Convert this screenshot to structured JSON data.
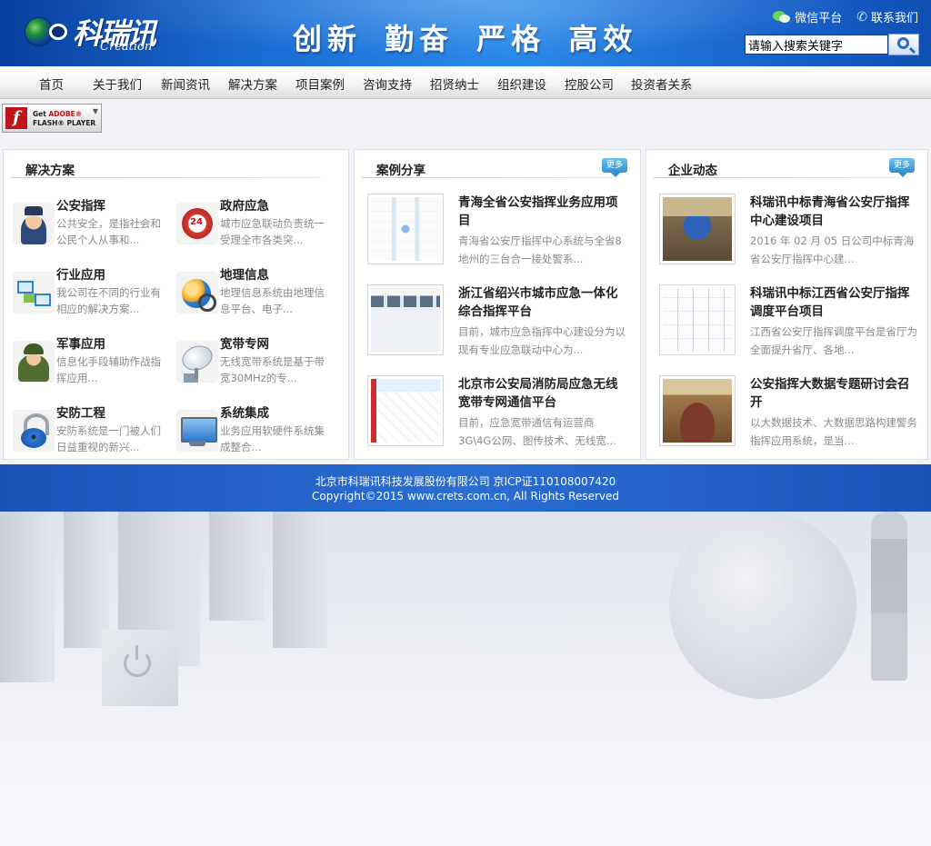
{
  "header": {
    "logo_cn": "科瑞讯",
    "logo_en": "Creation",
    "slogan": "创新 勤奋 严格 高效",
    "links": {
      "wechat": "微信平台",
      "contact": "联系我们"
    },
    "search": {
      "value": "请输入搜索关键字"
    }
  },
  "nav": {
    "items": [
      "首页",
      "关于我们",
      "新闻资讯",
      "解决方案",
      "项目案例",
      "咨询支持",
      "招贤纳士",
      "组织建设",
      "控股公司",
      "投资者关系"
    ]
  },
  "flash": {
    "line1": "Get ",
    "line1_red": "ADOBE®",
    "line2": "FLASH® PLAYER"
  },
  "solutions": {
    "title": "解决方案",
    "items": [
      {
        "title": "公安指挥",
        "desc": "公共安全，是指社会和公民个人从事和...",
        "icon": "police-icon"
      },
      {
        "title": "政府应急",
        "desc": "城市应急联动负责统一受理全市各类突...",
        "icon": "clock-24-icon"
      },
      {
        "title": "行业应用",
        "desc": "我公司在不同的行业有相应的解决方案...",
        "icon": "network-icon"
      },
      {
        "title": "地理信息",
        "desc": "地理信息系统由地理信息平台、电子...",
        "icon": "geo-globe-icon"
      },
      {
        "title": "军事应用",
        "desc": "信息化手段辅助作战指挥应用...",
        "icon": "soldier-icon"
      },
      {
        "title": "宽带专网",
        "desc": "无线宽带系统是基于带宽30MHz的专...",
        "icon": "satellite-dish-icon"
      },
      {
        "title": "安防工程",
        "desc": "安防系统是一门被人们日益重视的新兴...",
        "icon": "padlock-icon"
      },
      {
        "title": "系统集成",
        "desc": "业务应用软硬件系统集成整合...",
        "icon": "monitor-icon"
      }
    ]
  },
  "cases": {
    "title": "案例分享",
    "more": "更多",
    "items": [
      {
        "title": "青海全省公安指挥业务应用项目",
        "desc": "青海省公安厅指挥中心系统与全省8地州的三台合一接处警系..."
      },
      {
        "title": "浙江省绍兴市城市应急一体化综合指挥平台",
        "desc": "目前，城市应急指挥中心建设分为以现有专业应急联动中心为..."
      },
      {
        "title": "北京市公安局消防局应急无线宽带专网通信平台",
        "desc": "目前，应急宽带通信有运营商3G\\4G公网、图传技术、无线宽..."
      }
    ]
  },
  "news": {
    "title": "企业动态",
    "more": "更多",
    "items": [
      {
        "title": "科瑞讯中标青海省公安厅指挥中心建设项目",
        "desc": "2016 年 02 月 05 日公司中标青海省公安厅指挥中心建..."
      },
      {
        "title": "科瑞讯中标江西省公安厅指挥调度平台项目",
        "desc": "江西省公安厅指挥调度平台是省厅为全面提升省厅、各地..."
      },
      {
        "title": "公安指挥大数据专题研讨会召开",
        "desc": "以大数据技术、大数据思路构建警务指挥应用系统，是当..."
      }
    ]
  },
  "footer": {
    "line1": "北京市科瑞讯科技发展股份有限公司  京ICP证110108007420",
    "line2": "Copyright©2015  www.crets.com.cn, All Rights Reserved"
  },
  "colors": {
    "header_blue": "#1a6fd6",
    "footer_blue": "#2b6ed2",
    "muted_text": "#8a8a8a"
  }
}
